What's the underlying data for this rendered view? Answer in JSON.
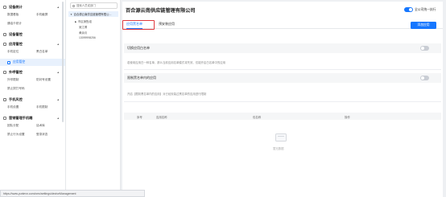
{
  "sidebar": {
    "sections": [
      {
        "title": "设备统计",
        "rows": [
          [
            "数据看板",
            "手机截屏"
          ],
          [
            "通话卡统计"
          ]
        ]
      },
      {
        "title": "设备管控",
        "rows": []
      },
      {
        "title": "应用管控",
        "rows": [
          [
            "手机定位",
            "黑白名单"
          ]
        ]
      },
      {
        "title": "外呼管控",
        "rows": [
          [
            "外呼限制",
            "防封号设置"
          ],
          [
            "禁止拨打号码"
          ]
        ]
      },
      {
        "title": "手机风控",
        "rows": [
          [
            "手机设置",
            "手机限制"
          ]
        ]
      },
      {
        "title": "营销管理手机端",
        "rows": [
          [
            "团队分配",
            "话术库"
          ],
          [
            "禁止行为设置",
            "登录状态"
          ]
        ]
      }
    ],
    "active_item": "应用管控"
  },
  "tree": {
    "search_placeholder": "搜索人员或部门",
    "root": "百合源云南供应链管理有限公...",
    "children": [
      "市区销售组",
      "吴江博",
      "黄余月",
      "13099998256"
    ]
  },
  "main": {
    "title": "百合源云南供应链管理有限公司",
    "global_label": "全公司统一执行",
    "global_enabled": true,
    "tabs": [
      "应用黑名单",
      "预安装应用"
    ],
    "active_tab": "应用黑名单",
    "add_button": "添加应用",
    "section1": {
      "title": "切换应用白名单",
      "enabled": false,
      "desc": "若使用应用白一种名单，那么当前应用名单模式将失效，仅能开启白名单中的应用"
    },
    "section2": {
      "title": "限制黑名单内的应用",
      "enabled": false,
      "desc": "开启【限制黑名单内的应用】对已经安装过黑名单的应用进行限制"
    },
    "table": {
      "columns": [
        "序号",
        "应用名称",
        "包名称",
        "操作"
      ],
      "empty_text": "暂无数据"
    }
  },
  "statusbar": {
    "url": "https://www.yunlevn.com/cms/settings/deviceManagement"
  }
}
